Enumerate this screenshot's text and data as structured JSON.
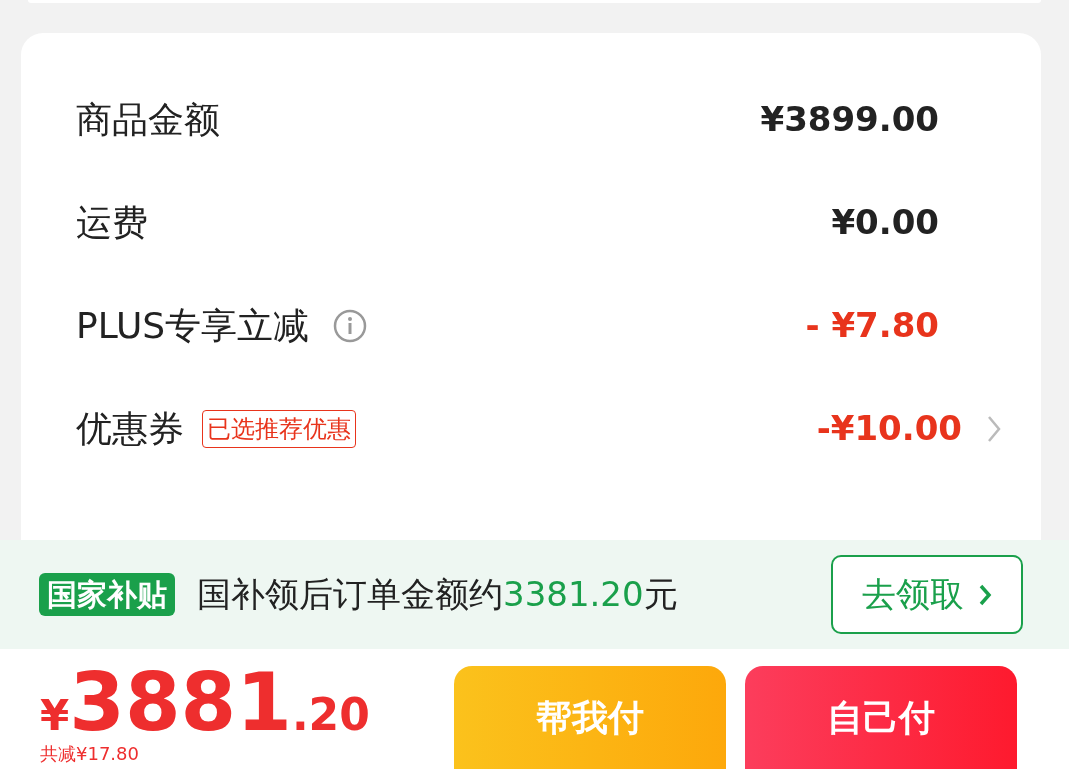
{
  "summary_rows": [
    {
      "kind": "plain",
      "label": "商品金额",
      "value": "¥3899.00",
      "discount": false
    },
    {
      "kind": "plain",
      "label": "运费",
      "value": "¥0.00",
      "discount": false
    },
    {
      "kind": "info",
      "label": "PLUS专享立减",
      "value": "- ¥7.80",
      "discount": true
    },
    {
      "kind": "coupon",
      "label": "优惠券",
      "tag": "已选推荐优惠",
      "value": "-¥10.00",
      "discount": true
    }
  ],
  "subsidy_banner": {
    "badge": "国家补贴",
    "text_before": "国补领后订单金额约",
    "amount": "3381.20",
    "text_after": "元",
    "button": "去领取"
  },
  "footer": {
    "currency": "¥",
    "price_main": "3881",
    "price_fraction": ".20",
    "saved": "共减¥17.80",
    "buttons": [
      {
        "kind": "friend",
        "label": "帮我付"
      },
      {
        "kind": "self",
        "label": "自己付"
      }
    ]
  }
}
